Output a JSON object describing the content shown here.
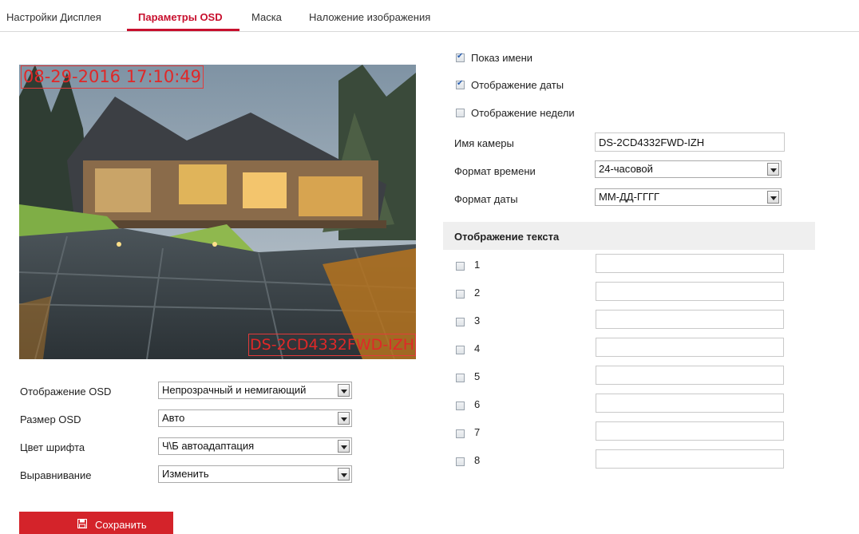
{
  "tabs": [
    {
      "label": "Настройки Дисплея",
      "active": false
    },
    {
      "label": "Параметры OSD",
      "active": true
    },
    {
      "label": "Маска",
      "active": false
    },
    {
      "label": "Наложение изображения",
      "active": false
    }
  ],
  "preview": {
    "osd_date": "08-29-2016 17:10:49",
    "osd_camera_name": "DS-2CD4332FWD-IZH"
  },
  "checkboxes": {
    "show_name": {
      "label": "Показ имени",
      "checked": true
    },
    "show_date": {
      "label": "Отображение даты",
      "checked": true
    },
    "show_week": {
      "label": "Отображение недели",
      "checked": false
    }
  },
  "camera_name": {
    "label": "Имя камеры",
    "value": "DS-2CD4332FWD-IZH"
  },
  "time_format": {
    "label": "Формат времени",
    "value": "24-часовой"
  },
  "date_format": {
    "label": "Формат даты",
    "value": "ММ-ДД-ГГГГ"
  },
  "text_overlay": {
    "title": "Отображение текста",
    "items": [
      {
        "label": "1",
        "checked": false,
        "value": ""
      },
      {
        "label": "2",
        "checked": false,
        "value": ""
      },
      {
        "label": "3",
        "checked": false,
        "value": ""
      },
      {
        "label": "4",
        "checked": false,
        "value": ""
      },
      {
        "label": "5",
        "checked": false,
        "value": ""
      },
      {
        "label": "6",
        "checked": false,
        "value": ""
      },
      {
        "label": "7",
        "checked": false,
        "value": ""
      },
      {
        "label": "8",
        "checked": false,
        "value": ""
      }
    ]
  },
  "osd_settings": {
    "display_mode": {
      "label": "Отображение OSD",
      "value": "Непрозрачный и немигающий"
    },
    "osd_size": {
      "label": "Размер OSD",
      "value": "Авто"
    },
    "font_color": {
      "label": "Цвет шрифта",
      "value": "Ч\\Б автоадаптация"
    },
    "alignment": {
      "label": "Выравнивание",
      "value": "Изменить"
    }
  },
  "save_button": {
    "label": "Сохранить"
  },
  "colors": {
    "accent": "#c8102e",
    "button": "#d4232a",
    "osd_text": "#e02828"
  }
}
